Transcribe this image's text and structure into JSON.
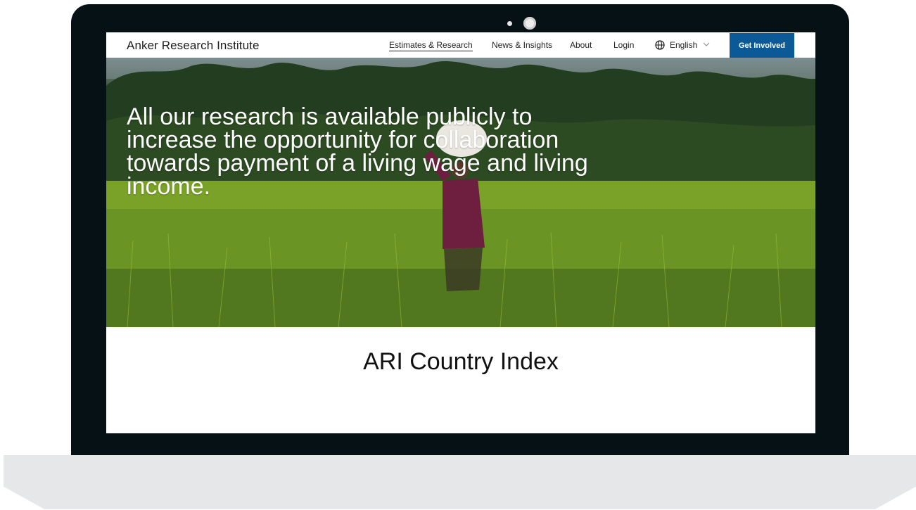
{
  "site": {
    "brand": "Anker Research Institute"
  },
  "nav": {
    "items": [
      {
        "label": "Estimates & Research",
        "active": true
      },
      {
        "label": "News & Insights",
        "active": false
      },
      {
        "label": "About",
        "active": false
      },
      {
        "label": "Login",
        "active": false
      }
    ],
    "language": {
      "label": "English",
      "icon": "globe-icon",
      "chevron": "chevron-down-icon"
    },
    "cta_label": "Get Involved"
  },
  "hero": {
    "headline": "All our research is available publicly to increase the opportunity for collaboration towards payment of a living wage and living income."
  },
  "main": {
    "section_title": "ARI Country Index"
  },
  "colors": {
    "bezel": "#061116",
    "base": "#e6e7e8",
    "cta_background": "#0b5a97",
    "cta_text": "#ffffff",
    "text_dark": "#1d1d1d"
  }
}
